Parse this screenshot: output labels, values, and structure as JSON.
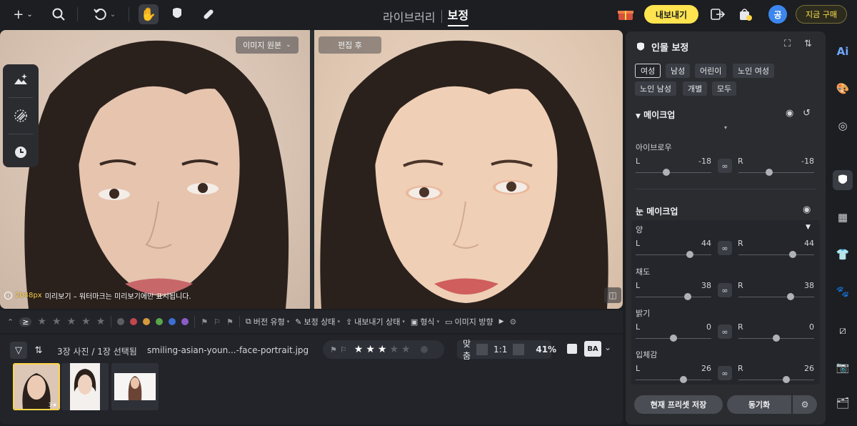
{
  "topbar": {
    "tabs": {
      "library": "라이브러리",
      "edit": "보정"
    },
    "export_label": "내보내기",
    "avatar_initial": "공",
    "buy_label": "지금 구매"
  },
  "canvas": {
    "before_label": "이미지 원본",
    "after_label": "편집 후",
    "preview_px": "2048px",
    "preview_text": "미리보기 – 워터마크는 미리보기에만 표시됩니다."
  },
  "filterbar": {
    "compare_symbol": "≥",
    "color_labels": [
      "#5a5d63",
      "#c2464e",
      "#d59a3c",
      "#5aa64a",
      "#3d6fd0",
      "#8b5cc7"
    ],
    "items": [
      "버전 유형",
      "보정 상태",
      "내보내기 상태",
      "형식",
      "이미지 방향"
    ]
  },
  "filmstrip": {
    "count": "3장 사진 / 1장 선택됨",
    "filename": "smiling-asian-youn...-face-portrait.jpg",
    "rating": 3,
    "rating_max": 5,
    "fit_label": "맞춤",
    "one_to_one": "1:1",
    "zoom": "41%",
    "view_mode": "BA",
    "thumb_badge": "3★"
  },
  "panel": {
    "title": "인물 보정",
    "chips": [
      "여성",
      "남성",
      "어린이",
      "노인 여성",
      "노인 남성",
      "개별",
      "모두"
    ],
    "active_chip": "여성",
    "section_makeup": "메이크업",
    "eyebrow": {
      "label": "아이브로우",
      "L": "-18",
      "R": "-18",
      "L_value": -18,
      "R_value": -18
    },
    "section_eye": "눈 메이크업",
    "eye_amount": {
      "label": "양",
      "L": "44",
      "R": "44",
      "L_value": 44,
      "R_value": 44
    },
    "saturation": {
      "label": "채도",
      "L": "38",
      "R": "38",
      "L_value": 38,
      "R_value": 38
    },
    "brightness": {
      "label": "밝기",
      "L": "0",
      "R": "0",
      "L_value": 0,
      "R_value": 0
    },
    "depth": {
      "label": "입체감",
      "L": "26",
      "R": "26",
      "L_value": 26,
      "R_value": 26
    },
    "lr_left": "L",
    "lr_right": "R",
    "save_preset": "현재 프리셋 저장",
    "sync": "동기화"
  },
  "rail": {
    "ai_label": "Ai"
  },
  "colors": {
    "accent": "#ffe34f",
    "avatar": "#3c86ee",
    "panel_bg": "#2a2c30",
    "app_bg": "#1c1e22"
  }
}
